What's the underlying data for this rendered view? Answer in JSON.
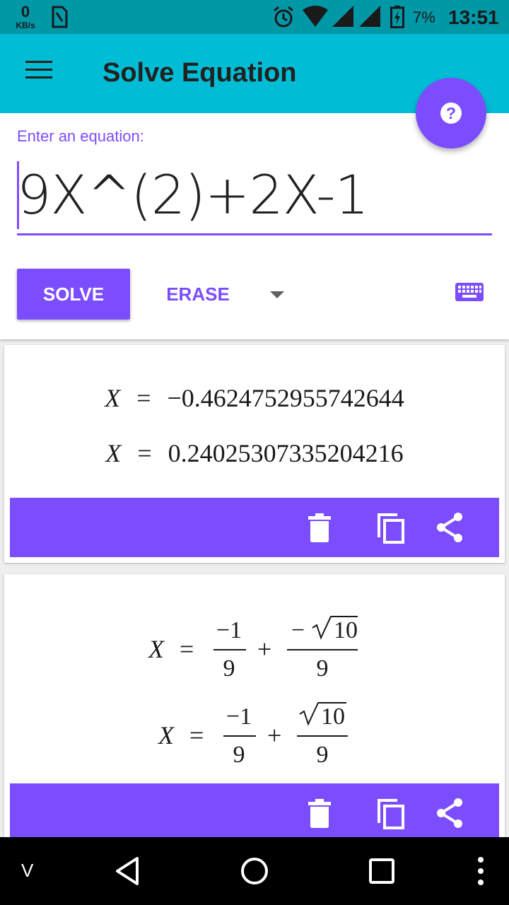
{
  "status_bar": {
    "speed_value": "0",
    "speed_unit": "KB/s",
    "battery_percent": "7%",
    "time": "13:51",
    "icons": [
      "sim-card-icon",
      "alarm-icon",
      "wifi-icon",
      "signal-icon",
      "signal-icon",
      "battery-charging-icon"
    ]
  },
  "app_bar": {
    "title": "Solve Equation",
    "menu_icon": "menu-icon",
    "help_icon": "help-icon"
  },
  "input": {
    "label": "Enter an equation:",
    "value": "9X^(2)+2X-1"
  },
  "buttons": {
    "solve": "SOLVE",
    "erase": "ERASE",
    "dropdown_icon": "dropdown-arrow-icon",
    "keyboard_icon": "keyboard-icon"
  },
  "results": [
    {
      "type": "decimal",
      "lines": [
        {
          "var": "X",
          "eq": "=",
          "value": "−0.4624752955742644"
        },
        {
          "var": "X",
          "eq": "=",
          "value": "0.24025307335204216"
        }
      ]
    },
    {
      "type": "exact",
      "lines": [
        {
          "var": "X",
          "eq": "=",
          "num1": "−1",
          "den1": "9",
          "op": "+",
          "num2_sign": "−",
          "num2_rad": "10",
          "den2": "9"
        },
        {
          "var": "X",
          "eq": "=",
          "num1": "−1",
          "den1": "9",
          "op": "+",
          "num2_sign": "",
          "num2_rad": "10",
          "den2": "9"
        }
      ]
    }
  ],
  "actions": [
    "delete-icon",
    "copy-icon",
    "share-icon"
  ],
  "nav_bar": {
    "left_label": "V",
    "icons": [
      "back-icon",
      "home-icon",
      "recents-icon",
      "more-icon"
    ]
  },
  "colors": {
    "status_bar": "#0097a7",
    "app_bar": "#00bcd4",
    "accent": "#7c4dff"
  }
}
